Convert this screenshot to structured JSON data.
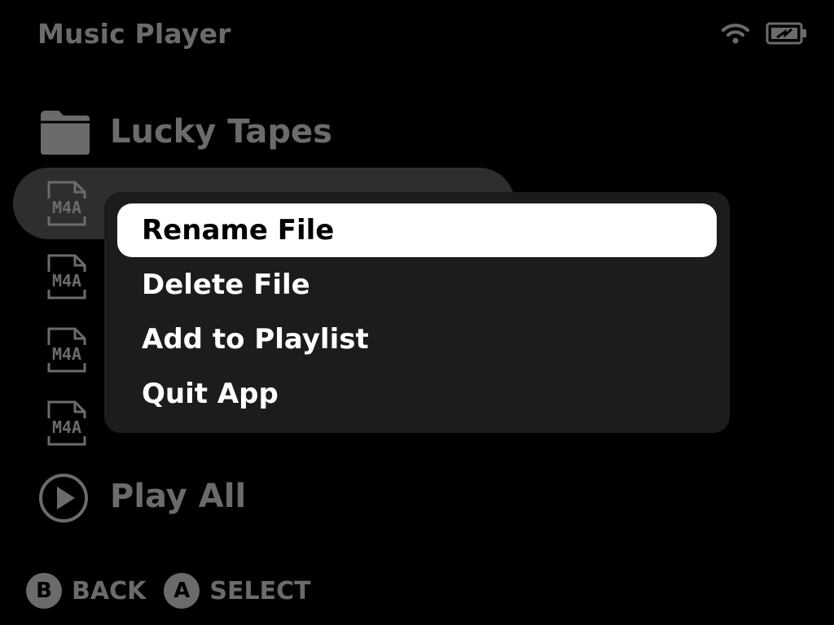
{
  "header": {
    "title": "Music Player",
    "wifi_icon": "wifi-icon",
    "battery_icon": "battery-charging-icon"
  },
  "list": {
    "items": [
      {
        "type": "folder",
        "icon": "folder-icon",
        "label": "Lucky Tapes"
      },
      {
        "type": "file",
        "icon": "m4a-file-icon",
        "badge": "M4A",
        "label": "",
        "selected": true
      },
      {
        "type": "file",
        "icon": "m4a-file-icon",
        "badge": "M4A",
        "label": ""
      },
      {
        "type": "file",
        "icon": "m4a-file-icon",
        "badge": "M4A",
        "label": ""
      },
      {
        "type": "file",
        "icon": "m4a-file-icon",
        "badge": "M4A",
        "label": ""
      },
      {
        "type": "action",
        "icon": "play-circle-icon",
        "label": "Play All"
      }
    ]
  },
  "context_menu": {
    "items": [
      {
        "label": "Rename File",
        "selected": true
      },
      {
        "label": "Delete File"
      },
      {
        "label": "Add to Playlist"
      },
      {
        "label": "Quit App"
      }
    ]
  },
  "footer": {
    "back_key": "B",
    "back_label": "BACK",
    "select_key": "A",
    "select_label": "SELECT"
  }
}
